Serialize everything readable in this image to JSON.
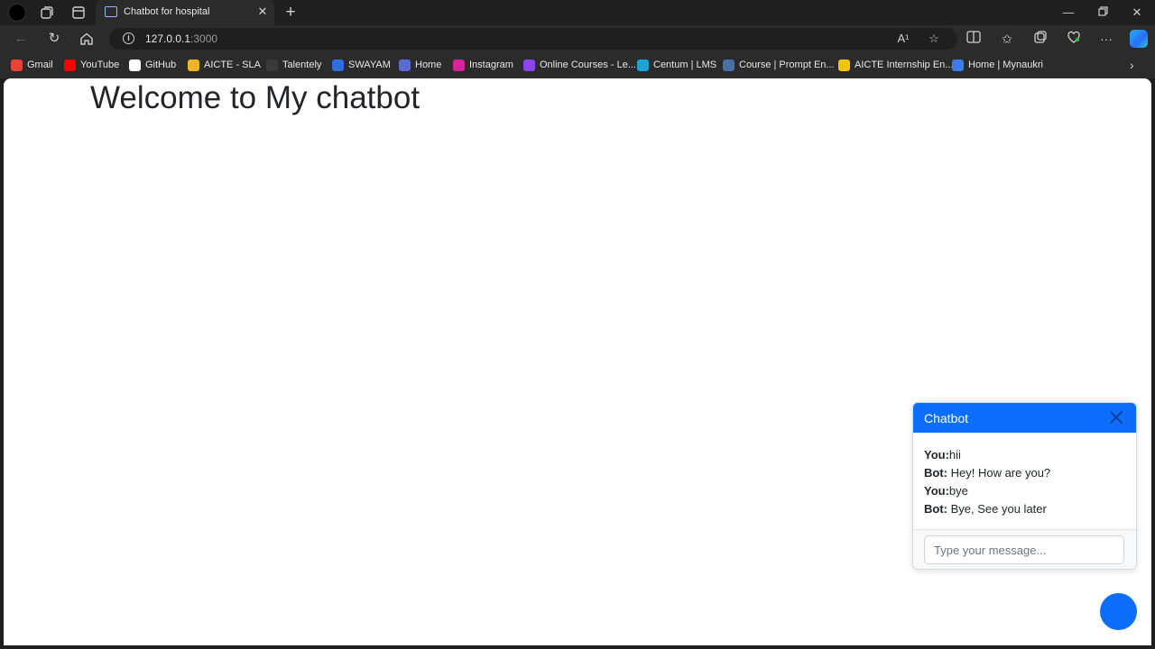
{
  "browser": {
    "tab_title": "Chatbot for hospital",
    "url_host": "127.0.0.1",
    "url_port": ":3000",
    "read_aloud_glyph": "A¹"
  },
  "bookmarks": [
    {
      "label": "Gmail",
      "color": "#ea4335"
    },
    {
      "label": "YouTube",
      "color": "#ff0000"
    },
    {
      "label": "GitHub",
      "color": "#ffffff"
    },
    {
      "label": "AICTE - SLA",
      "color": "#f0b429"
    },
    {
      "label": "Talentely",
      "color": "#3a3a3a"
    },
    {
      "label": "SWAYAM",
      "color": "#2f6ee0"
    },
    {
      "label": "Home",
      "color": "#5b6bd6"
    },
    {
      "label": "Instagram",
      "color": "#d6249f"
    },
    {
      "label": "Online Courses - Le...",
      "color": "#8e44ec"
    },
    {
      "label": "Centum | LMS",
      "color": "#1aa3d9"
    },
    {
      "label": "Course | Prompt En...",
      "color": "#4a6fa5"
    },
    {
      "label": "AICTE Internship En...",
      "color": "#f2c500"
    },
    {
      "label": "Home | Mynaukri",
      "color": "#3d7bf0"
    }
  ],
  "page": {
    "heading": "Welcome to My chatbot"
  },
  "chat": {
    "title": "Chatbot",
    "messages": [
      {
        "sender": "You:",
        "text": "hii"
      },
      {
        "sender": "Bot:",
        "text": " Hey! How are you?"
      },
      {
        "sender": "You:",
        "text": "bye"
      },
      {
        "sender": "Bot:",
        "text": " Bye, See you later"
      }
    ],
    "input_placeholder": "Type your message...",
    "input_value": ""
  },
  "colors": {
    "accent": "#0d6efd",
    "browser_chrome": "#2b2b2b"
  }
}
